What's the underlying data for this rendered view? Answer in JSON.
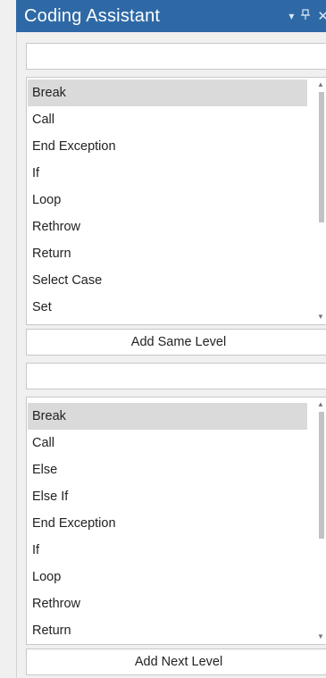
{
  "titlebar": {
    "title": "Coding Assistant",
    "dropdown_glyph": "▾",
    "pin_glyph": "ꟷ",
    "close_glyph": "✕"
  },
  "top_section": {
    "search_value": "",
    "list_items": [
      "Break",
      "Call",
      "End Exception",
      "If",
      "Loop",
      "Rethrow",
      "Return",
      "Select Case",
      "Set"
    ],
    "selected_index": 0,
    "add_button_label": "Add Same Level"
  },
  "bottom_section": {
    "search_value": "",
    "list_items": [
      "Break",
      "Call",
      "Else",
      "Else If",
      "End Exception",
      "If",
      "Loop",
      "Rethrow",
      "Return"
    ],
    "selected_index": 0,
    "add_button_label": "Add Next Level"
  },
  "icons": {
    "up_arrow": "▲",
    "down_arrow": "▼"
  },
  "colors": {
    "titlebar_bg": "#2e69a6",
    "selection_bg": "#dadada",
    "panel_bg": "#f0f0f0"
  }
}
